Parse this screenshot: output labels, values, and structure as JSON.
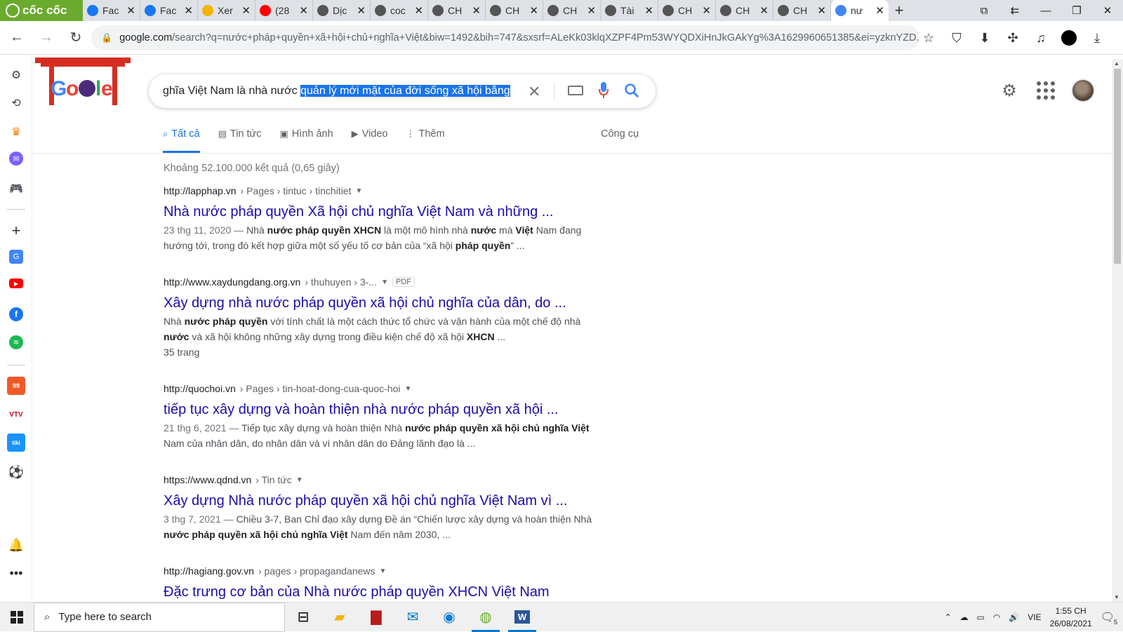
{
  "browser": {
    "brand": "cốc cốc",
    "tabs": [
      {
        "title": "Fac",
        "icon": "facebook-icon",
        "color": "#1877f2",
        "active": false
      },
      {
        "title": "Fac",
        "icon": "facebook-icon",
        "color": "#1877f2",
        "active": false
      },
      {
        "title": "Xer",
        "icon": "xem-icon",
        "color": "#f4b400",
        "active": false
      },
      {
        "title": "(28",
        "icon": "youtube-icon",
        "color": "#ff0000",
        "active": false
      },
      {
        "title": "Dịc",
        "icon": "translate-icon",
        "color": "#555555",
        "active": false
      },
      {
        "title": "coc",
        "icon": "download-icon",
        "color": "#555555",
        "active": false
      },
      {
        "title": "CH",
        "icon": "globe-icon",
        "color": "#555555",
        "active": false
      },
      {
        "title": "CH",
        "icon": "globe-icon",
        "color": "#555555",
        "active": false
      },
      {
        "title": "CH",
        "icon": "globe-icon",
        "color": "#555555",
        "active": false
      },
      {
        "title": "Tài",
        "icon": "globe-icon",
        "color": "#555555",
        "active": false
      },
      {
        "title": "CH",
        "icon": "globe-icon",
        "color": "#555555",
        "active": false
      },
      {
        "title": "CH",
        "icon": "globe-icon",
        "color": "#555555",
        "active": false
      },
      {
        "title": "CH",
        "icon": "globe-icon",
        "color": "#555555",
        "active": false
      },
      {
        "title": "nư",
        "icon": "google-icon",
        "color": "#4285f4",
        "active": true
      }
    ],
    "url_host": "google.com",
    "url_rest": "/search?q=nước+pháp+quyền+xã+hội+chủ+nghĩa+Việt&biw=1492&bih=747&sxsrf=ALeKk03klqXZPF4Pm53WYQDXiHnJkGAkYg%3A1629960651385&ei=yzknYZD..."
  },
  "google": {
    "query_plain": "ghĩa Việt Nam là nhà nước ",
    "query_selected": "quản lý mới mặt của đời sống xã hội bằng",
    "tabs": [
      {
        "label": "Tất cả",
        "icon": "search-icon",
        "glyph": "⌕",
        "active": true
      },
      {
        "label": "Tin tức",
        "icon": "news-icon",
        "glyph": "▤",
        "active": false
      },
      {
        "label": "Hình ảnh",
        "icon": "image-icon",
        "glyph": "▣",
        "active": false
      },
      {
        "label": "Video",
        "icon": "video-icon",
        "glyph": "▶",
        "active": false
      },
      {
        "label": "Thêm",
        "icon": "more-vert-icon",
        "glyph": "⋮",
        "active": false
      }
    ],
    "tools_label": "Công cụ",
    "stats": "Khoảng 52.100.000 kết quả (0,65 giây)"
  },
  "results": [
    {
      "host": "http://lapphap.vn",
      "path": " › Pages › tintuc › tinchitiet",
      "pdf": "",
      "title": "Nhà nước pháp quyền Xã hội chủ nghĩa Việt Nam và những ...",
      "snippet_html": "<span class=\"r-date\">23 thg 11, 2020 — </span>Nhà <b>nước pháp quyền XHCN</b> là một mô hình nhà <b>nước</b> mà <b>Việt</b> Nam đang hướng tới, trong đó kết hợp giữa một số yếu tố cơ bản của “xã hội <b>pháp quyền</b>” ..."
    },
    {
      "host": "http://www.xaydungdang.org.vn",
      "path": " › thuhuyen › 3-...",
      "pdf": "PDF",
      "title": "Xây dựng nhà nước pháp quyền xã hội chủ nghĩa của dân, do ...",
      "snippet_html": "Nhà <b>nước pháp quyền</b> với tính chất là một cách thức tổ chức và vận hành của một chế độ nhà <b>nước</b> và xã hội không những xây dựng trong điều kiện chế độ xã hội <b>XHCN</b> ...<br>35 trang"
    },
    {
      "host": "http://quochoi.vn",
      "path": " › Pages › tin-hoat-dong-cua-quoc-hoi",
      "pdf": "",
      "title": "tiếp tục xây dựng và hoàn thiện nhà nước pháp quyền xã hội ...",
      "snippet_html": "<span class=\"r-date\">21 thg 6, 2021 — </span>Tiếp tục xây dựng và hoàn thiện Nhà <b>nước pháp quyền xã hội chủ nghĩa Việt</b> Nam của nhân dân, do nhân dân và vì nhân dân do Đảng lãnh đạo là ..."
    },
    {
      "host": "https://www.qdnd.vn",
      "path": " › Tin tức",
      "pdf": "",
      "title": "Xây dựng Nhà nước pháp quyền xã hội chủ nghĩa Việt Nam vì ...",
      "snippet_html": "<span class=\"r-date\">3 thg 7, 2021 — </span>Chiều 3-7, Ban Chỉ đạo xây dựng Đề án “Chiến lược xây dựng và hoàn thiện Nhà <b>nước pháp quyền xã hội chủ nghĩa Việt</b> Nam đến năm 2030, ..."
    },
    {
      "host": "http://hagiang.gov.vn",
      "path": " › pages › propagandanews",
      "pdf": "",
      "title": "Đặc trưng cơ bản của Nhà nước pháp quyền XHCN Việt Nam",
      "snippet_html": ""
    }
  ],
  "taskbar": {
    "search_placeholder": "Type here to search",
    "lang": "VIE",
    "time": "1:55 CH",
    "date": "26/08/2021",
    "notif_count": "5"
  }
}
